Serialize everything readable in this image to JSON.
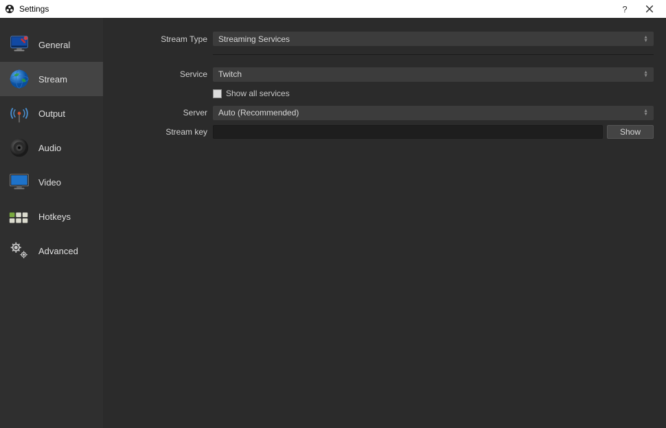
{
  "titlebar": {
    "title": "Settings",
    "help": "?",
    "close": "✕"
  },
  "sidebar": {
    "items": [
      {
        "id": "general",
        "label": "General",
        "icon": "monitor-wrench-icon"
      },
      {
        "id": "stream",
        "label": "Stream",
        "icon": "globe-icon"
      },
      {
        "id": "output",
        "label": "Output",
        "icon": "antenna-icon"
      },
      {
        "id": "audio",
        "label": "Audio",
        "icon": "speaker-icon"
      },
      {
        "id": "video",
        "label": "Video",
        "icon": "monitor-icon"
      },
      {
        "id": "hotkeys",
        "label": "Hotkeys",
        "icon": "keyboard-icon"
      },
      {
        "id": "advanced",
        "label": "Advanced",
        "icon": "gears-icon"
      }
    ],
    "active_id": "stream"
  },
  "form": {
    "stream_type": {
      "label": "Stream Type",
      "value": "Streaming Services"
    },
    "service": {
      "label": "Service",
      "value": "Twitch"
    },
    "show_all_services": {
      "label": "Show all services",
      "checked": false
    },
    "server": {
      "label": "Server",
      "value": "Auto (Recommended)"
    },
    "stream_key": {
      "label": "Stream key",
      "value": "",
      "show_button": "Show"
    }
  }
}
